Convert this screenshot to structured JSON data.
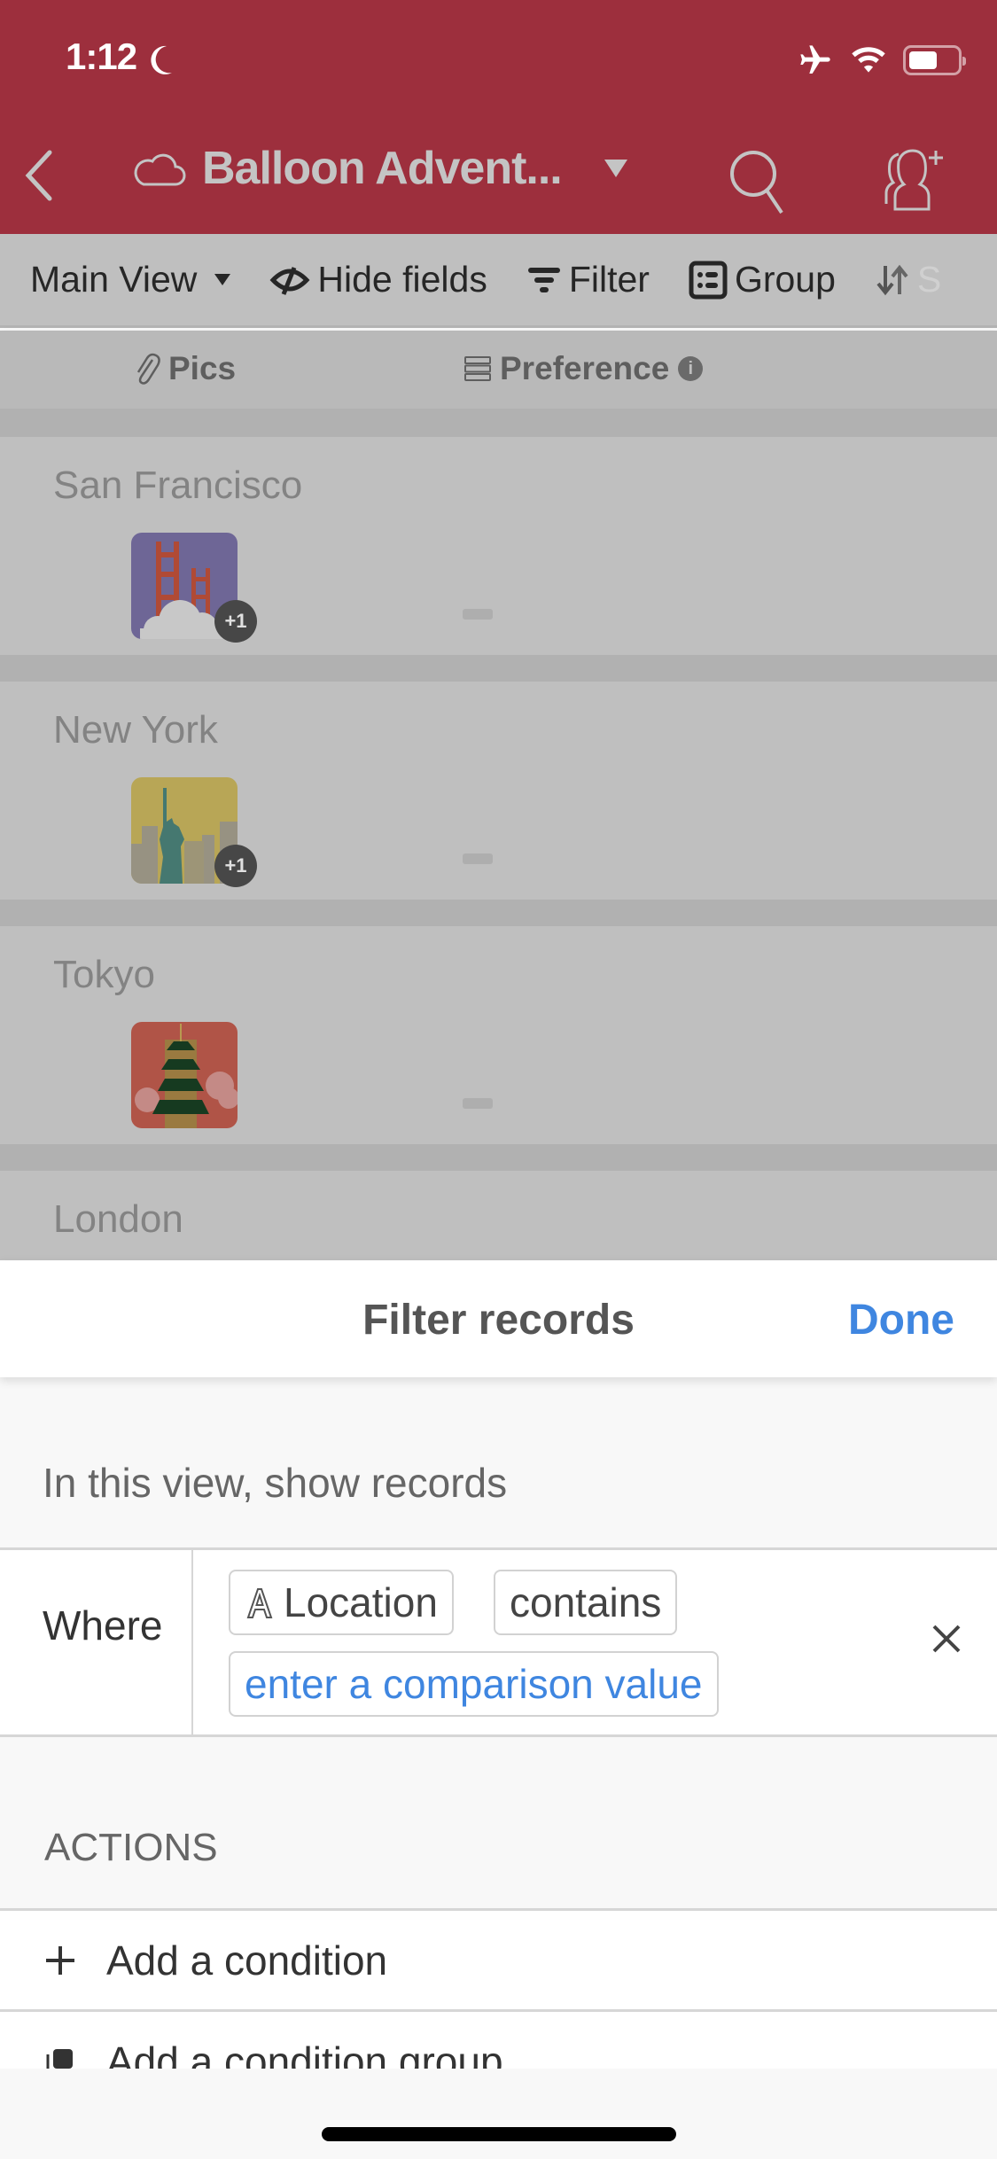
{
  "status_bar": {
    "time": "1:12",
    "icons": [
      "moon-icon",
      "airplane-icon",
      "wifi-icon",
      "battery-icon"
    ],
    "battery_level": 0.6
  },
  "nav": {
    "back_icon": "chevron-left-icon",
    "base_icon": "cloud-icon",
    "title": "Balloon Advent...",
    "search_icon": "search-icon",
    "share_icon": "add-collaborator-icon"
  },
  "toolbar": {
    "view_label": "Main View",
    "hide_fields_label": "Hide fields",
    "filter_label": "Filter",
    "group_label": "Group",
    "sort_label": "S"
  },
  "columns": {
    "pics": "Pics",
    "preference": "Preference"
  },
  "records": [
    {
      "name": "San Francisco",
      "attachments_extra": "+1",
      "preference": ""
    },
    {
      "name": "New York",
      "attachments_extra": "+1",
      "preference": ""
    },
    {
      "name": "Tokyo",
      "attachments_extra": "",
      "preference": ""
    },
    {
      "name": "London",
      "attachments_extra": "",
      "preference": ""
    }
  ],
  "filter_sheet": {
    "title": "Filter records",
    "done_label": "Done",
    "intro": "In this view, show records",
    "condition": {
      "conjunction": "Where",
      "field": "Location",
      "field_type_icon": "text-field-icon",
      "operator": "contains",
      "value_placeholder": "enter a comparison value"
    },
    "actions_header": "ACTIONS",
    "actions": [
      {
        "icon": "plus-icon",
        "label": "Add a condition"
      },
      {
        "icon": "condition-group-icon",
        "label": "Add a condition group"
      }
    ]
  },
  "colors": {
    "brand_red": "#9d2f3d",
    "accent_blue": "#3f86e0"
  }
}
